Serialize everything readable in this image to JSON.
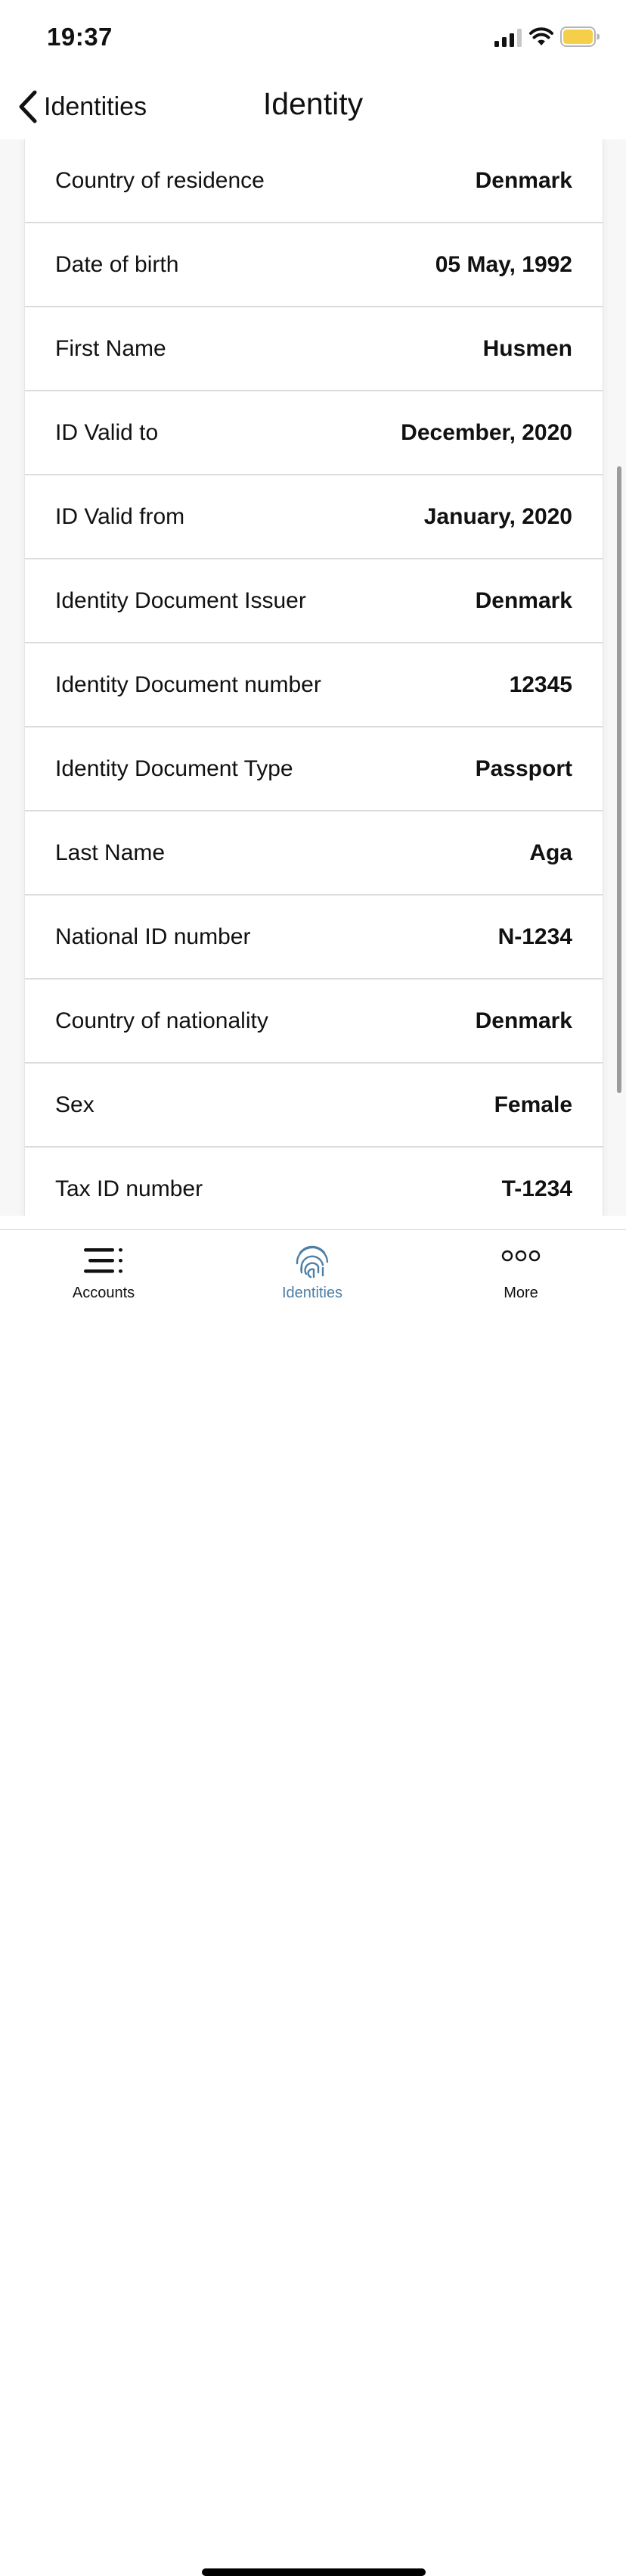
{
  "status_bar": {
    "time": "19:37",
    "icons": [
      "signal-icon",
      "wifi-icon",
      "battery-icon"
    ],
    "battery_color": "#f5cf47"
  },
  "nav": {
    "back_label": "Identities",
    "title": "Identity"
  },
  "fields": [
    {
      "label": "Country of residence",
      "value": "Denmark"
    },
    {
      "label": "Date of birth",
      "value": "05 May, 1992"
    },
    {
      "label": "First Name",
      "value": "Husmen"
    },
    {
      "label": "ID Valid to",
      "value": "December, 2020"
    },
    {
      "label": "ID Valid from",
      "value": "January, 2020"
    },
    {
      "label": "Identity Document Issuer",
      "value": "Denmark"
    },
    {
      "label": "Identity Document number",
      "value": "12345"
    },
    {
      "label": "Identity Document Type",
      "value": "Passport"
    },
    {
      "label": "Last Name",
      "value": "Aga"
    },
    {
      "label": "National ID number",
      "value": "N-1234"
    },
    {
      "label": "Country of nationality",
      "value": "Denmark"
    },
    {
      "label": "Sex",
      "value": "Female"
    },
    {
      "label": "Tax ID number",
      "value": "T-1234"
    }
  ],
  "tab_bar": {
    "tabs": [
      {
        "label": "Accounts",
        "icon": "accounts-list-icon",
        "active": false
      },
      {
        "label": "Identities",
        "icon": "fingerprint-icon",
        "active": true
      },
      {
        "label": "More",
        "icon": "more-dots-icon",
        "active": false
      }
    ],
    "active_color": "#4d7fa6"
  }
}
